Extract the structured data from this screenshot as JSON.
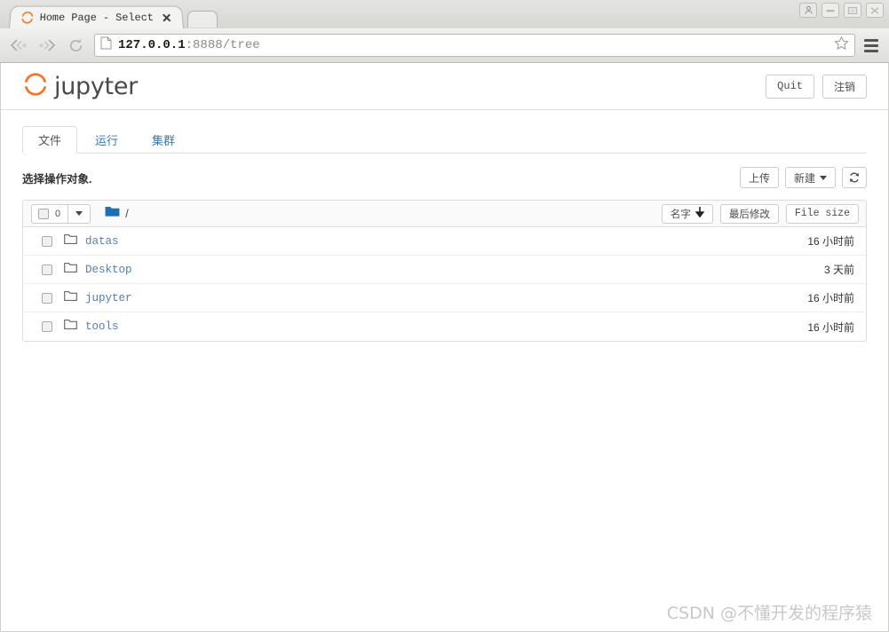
{
  "browser": {
    "tab": {
      "title": "Home Page - Select",
      "favicon_icon": "jupyter-favicon",
      "close_icon": "close-icon"
    },
    "new_tab_icon": "new-tab-icon",
    "window_controls": [
      {
        "name": "user-profile",
        "icon": "person-icon"
      },
      {
        "name": "minimize",
        "icon": "minimize-icon"
      },
      {
        "name": "maximize",
        "icon": "maximize-icon"
      },
      {
        "name": "close",
        "icon": "close-window-icon"
      }
    ],
    "nav": {
      "back_icon": "back-arrow-icon",
      "forward_icon": "forward-arrow-icon",
      "reload_icon": "reload-icon",
      "page_icon": "page-document-icon",
      "bookmark_icon": "star-icon",
      "menu_icon": "hamburger-menu-icon"
    },
    "url": {
      "host": "127.0.0.1",
      "rest": ":8888/tree",
      "full": "127.0.0.1:8888/tree"
    }
  },
  "header": {
    "logo_text": "jupyter",
    "logo_icon": "jupyter-logo-icon",
    "quit_label": "Quit",
    "logout_label": "注销"
  },
  "tabs": [
    {
      "label": "文件",
      "name": "tab-files",
      "active": true
    },
    {
      "label": "运行",
      "name": "tab-running",
      "active": false
    },
    {
      "label": "集群",
      "name": "tab-clusters",
      "active": false
    }
  ],
  "actions": {
    "select_hint": "选择操作对象.",
    "upload_label": "上传",
    "new_label": "新建",
    "refresh_icon": "refresh-icon"
  },
  "list_header": {
    "select_count": "0",
    "select_caret_icon": "chevron-down-icon",
    "folder_icon": "folder-filled-icon",
    "breadcrumb_path": "/",
    "sort_name_label": "名字",
    "sort_name_arrow": "↓",
    "sort_modified_label": "最后修改",
    "sort_size_label": "File size"
  },
  "files": [
    {
      "name": "datas",
      "icon": "folder-outline-icon",
      "modified": "16 小时前"
    },
    {
      "name": "Desktop",
      "icon": "folder-outline-icon",
      "modified": "3 天前"
    },
    {
      "name": "jupyter",
      "icon": "folder-outline-icon",
      "modified": "16 小时前"
    },
    {
      "name": "tools",
      "icon": "folder-outline-icon",
      "modified": "16 小时前"
    }
  ],
  "watermark": "CSDN @不懂开发的程序猿",
  "colors": {
    "jupyter_orange": "#f37726",
    "link_blue": "#5c7ca8",
    "tab_blue": "#337ab7",
    "folder_blue": "#1f6fb5"
  }
}
